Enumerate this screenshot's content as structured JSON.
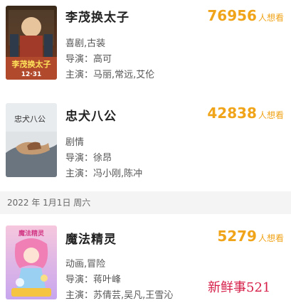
{
  "movies": [
    {
      "title": "李茂换太子",
      "want_count": "76956",
      "want_unit": "人想看",
      "genre": "喜剧,古装",
      "director_label": "导演：",
      "director": "高可",
      "cast_label": "主演：",
      "cast": "马丽,常远,艾伦",
      "poster_text": "李茂换太子",
      "poster_date": "12·31"
    },
    {
      "title": "忠犬八公",
      "want_count": "42838",
      "want_unit": "人想看",
      "genre": "剧情",
      "director_label": "导演：",
      "director": "徐昂",
      "cast_label": "主演：",
      "cast": "冯小刚,陈冲",
      "poster_text": "忠犬八公"
    },
    {
      "title": "魔法精灵",
      "want_count": "5279",
      "want_unit": "人想看",
      "genre": "动画,冒险",
      "director_label": "导演：",
      "director": "蒋叶峰",
      "cast_label": "主演：",
      "cast": "苏倩芸,吴凡,王雪沁",
      "poster_text": "魔法精灵"
    }
  ],
  "date_separator": "2022 年 1月1日 周六",
  "watermark": "新鲜事521",
  "colors": {
    "want_count": "#f0a41a",
    "date_bar_bg": "#f4f4f4",
    "watermark": "#d6204a"
  }
}
